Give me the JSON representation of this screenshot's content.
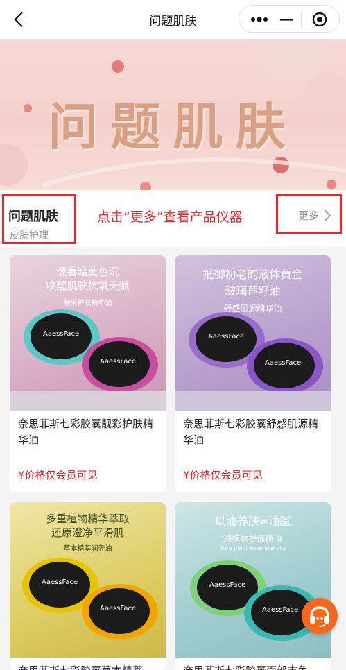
{
  "nav": {
    "title": "问题肌肤"
  },
  "banner": {
    "title": "问题肌肤"
  },
  "section": {
    "title": "问题肌肤",
    "subtitle": "皮肤护理",
    "hint": "点击“更多”查看产品仪器",
    "more_label": "更多"
  },
  "products": [
    {
      "name": "奈思菲斯七彩胶囊靓彩护肤精华油",
      "price": "¥价格仅会员可见",
      "promo_line1": "改善暗黄色沉",
      "promo_line2": "唤醒肌肤抗氧天赋",
      "promo_tag": "靓采护肤精华油",
      "bg": "#d9b2c8",
      "ring": "#c84fa0"
    },
    {
      "name": "奈思菲斯七彩胶囊舒感肌源精华油",
      "price": "¥价格仅会员可见",
      "promo_line1": "抵御初老的液体黄金",
      "promo_line2": "玻璃苣籽油",
      "promo_tag": "舒感肌源精华油",
      "bg": "#b59fcb",
      "ring": "#8a55c8"
    },
    {
      "name": "奈思菲斯七彩胶囊草本精萃",
      "price": "",
      "promo_line1": "多重植物精华萃取",
      "promo_line2": "还原澄净平滑肌",
      "promo_tag": "草本精萃润养油",
      "bg": "#d9c75a",
      "ring": "#e6c400"
    },
    {
      "name": "奈思菲斯七彩胶囊面部志角",
      "price": "",
      "promo_line1": "以油养肤≠油腻",
      "promo_line2": "纯植物提炼精油",
      "promo_tag": "Pure plant essential oils",
      "bg": "#9cc9cc",
      "ring": "#38b9b4"
    }
  ],
  "product_brand": "AaessFace"
}
